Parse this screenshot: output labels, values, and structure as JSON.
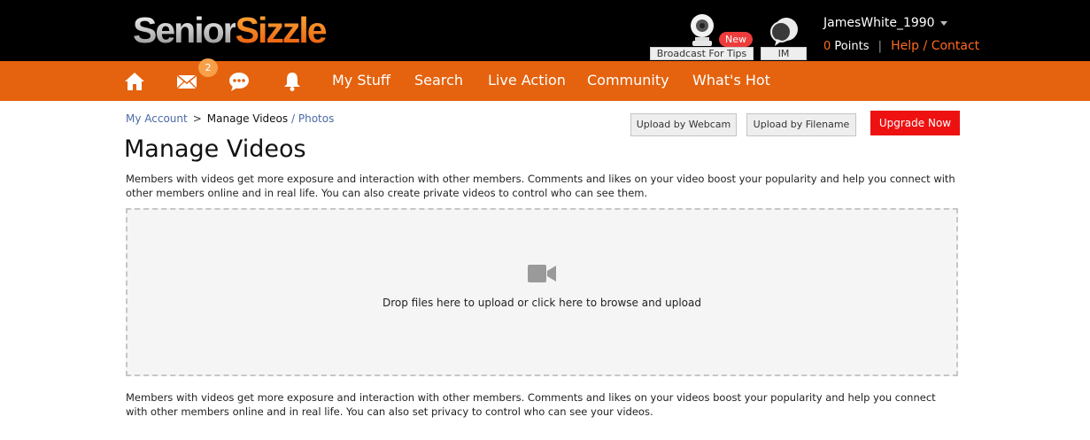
{
  "header": {
    "logo_part1": "Senior",
    "logo_part2": "Sizzle",
    "broadcast_label": "Broadcast For Tips",
    "new_badge": "New",
    "im_label": "IM",
    "username": "JamesWhite_1990",
    "points_value": "0",
    "points_label": "Points",
    "separator": "|",
    "help_link": "Help / Contact"
  },
  "nav": {
    "message_badge": "2",
    "items": [
      "My Stuff",
      "Search",
      "Live Action",
      "Community",
      "What's Hot"
    ],
    "icons": [
      "home-icon",
      "mail-icon",
      "chat-bubble-icon",
      "bell-icon"
    ]
  },
  "breadcrumb": {
    "account": "My Account",
    "separator": ">",
    "current": "Manage Videos",
    "slash": "/",
    "photos": "Photos"
  },
  "actions": {
    "upload_webcam": "Upload by Webcam",
    "upload_filename": "Upload by Filename",
    "upgrade": "Upgrade Now"
  },
  "main": {
    "title": "Manage Videos",
    "intro": "Members with videos get more exposure and interaction with other members. Comments and likes on your video boost your popularity and help you connect with other members online and in real life. You can also create private videos to control who can see them.",
    "dropzone_text": "Drop files here to upload or click here to browse and upload",
    "footer_text": "Members with videos get more exposure and interaction with other members. Comments and likes on your videos boost your popularity and help you connect with other members online and in real life. You can also set privacy to control who can see your videos."
  },
  "colors": {
    "nav_orange": "#e5620e",
    "accent_orange": "#ff6a1f",
    "upgrade_red": "#ee1111",
    "badge_red": "#ee3b3b"
  }
}
